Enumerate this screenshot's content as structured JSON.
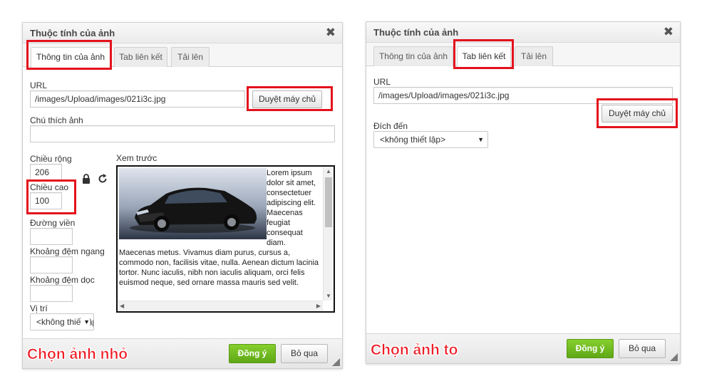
{
  "left_dialog": {
    "title": "Thuộc tính của ảnh",
    "tabs": [
      {
        "label": "Thông tin của ảnh",
        "active": true
      },
      {
        "label": "Tab liên kết",
        "active": false
      },
      {
        "label": "Tải lên",
        "active": false
      }
    ],
    "url_label": "URL",
    "url_value": "/images/Upload/images/021i3c.jpg",
    "browse_label": "Duyệt máy chủ",
    "alt_label": "Chú thích ảnh",
    "alt_value": "",
    "width_label": "Chiều rộng",
    "width_value": "206",
    "height_label": "Chiều cao",
    "height_value": "100",
    "border_label": "Đường viền",
    "border_value": "",
    "hspace_label": "Khoảng đệm ngang",
    "hspace_value": "",
    "vspace_label": "Khoảng đệm dọc",
    "vspace_value": "",
    "align_label": "Vị trí",
    "align_value": "<không thiết lập>",
    "preview_label": "Xem trước",
    "preview_text": "Lorem ipsum dolor sit amet, consectetuer adipiscing elit. Maecenas feugiat consequat diam. Maecenas metus. Vivamus diam purus, cursus a, commodo non, facilisis vitae, nulla. Aenean dictum lacinia tortor. Nunc iaculis, nibh non iaculis aliquam, orci felis euismod neque, sed ornare massa mauris sed velit.",
    "ok_label": "Đồng ý",
    "cancel_label": "Bỏ qua",
    "caption": "Chọn ảnh nhỏ"
  },
  "right_dialog": {
    "title": "Thuộc tính của ảnh",
    "tabs": [
      {
        "label": "Thông tin của ảnh",
        "active": false
      },
      {
        "label": "Tab liên kết",
        "active": true
      },
      {
        "label": "Tải lên",
        "active": false
      }
    ],
    "url_label": "URL",
    "url_value": "/images/Upload/images/021i3c.jpg",
    "browse_label": "Duyệt máy chủ",
    "target_label": "Đích đến",
    "target_value": "<không thiết lập>",
    "ok_label": "Đồng ý",
    "cancel_label": "Bỏ qua",
    "caption": "Chọn ảnh to"
  },
  "colors": {
    "highlight": "#e3121c",
    "ok_green": "#6cb820",
    "caption_red": "#ee1c24"
  },
  "icons": {
    "close": "close-icon",
    "lock": "lock-icon",
    "reset": "reset-size-icon",
    "dropdown": "dropdown-arrow-icon",
    "resize": "resize-handle-icon"
  }
}
